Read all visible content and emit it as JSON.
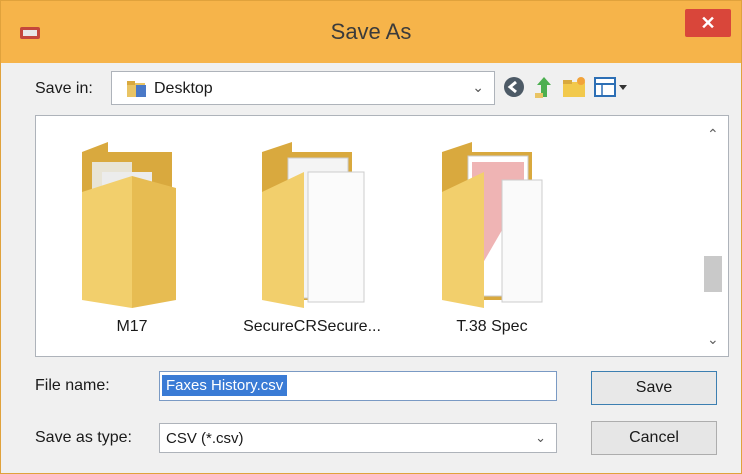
{
  "window": {
    "title": "Save As",
    "close_label": "✕"
  },
  "toolbar": {
    "save_in_label": "Save in:",
    "save_in_value": "Desktop",
    "icons": [
      "back-icon",
      "up-folder-icon",
      "new-folder-icon",
      "view-menu-icon"
    ]
  },
  "files": [
    {
      "name": "M17"
    },
    {
      "name": "SecureCRSecure..."
    },
    {
      "name": "T.38 Spec"
    }
  ],
  "form": {
    "file_name_label": "File name:",
    "file_name_value": "Faxes History.csv",
    "save_type_label": "Save as type:",
    "save_type_value": "CSV (*.csv)"
  },
  "buttons": {
    "save": "Save",
    "cancel": "Cancel"
  },
  "colors": {
    "titlebar": "#f6b44a",
    "close": "#d9463a",
    "selection": "#3a7bd5"
  }
}
